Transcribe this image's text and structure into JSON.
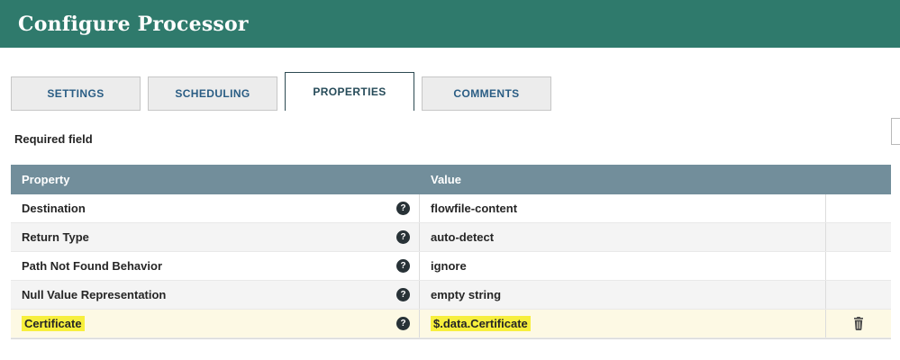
{
  "dialog": {
    "title": "Configure Processor"
  },
  "tabs": [
    {
      "label": "SETTINGS",
      "active": false
    },
    {
      "label": "SCHEDULING",
      "active": false
    },
    {
      "label": "PROPERTIES",
      "active": true
    },
    {
      "label": "COMMENTS",
      "active": false
    }
  ],
  "properties_panel": {
    "required_field_label": "Required field"
  },
  "table": {
    "columns": {
      "property": "Property",
      "value": "Value"
    },
    "rows": [
      {
        "property": "Destination",
        "value": "flowfile-content",
        "highlight": false
      },
      {
        "property": "Return Type",
        "value": "auto-detect",
        "highlight": false
      },
      {
        "property": "Path Not Found Behavior",
        "value": "ignore",
        "highlight": false
      },
      {
        "property": "Null Value Representation",
        "value": "empty string",
        "highlight": false
      },
      {
        "property": "Certificate",
        "value": "$.data.Certificate",
        "highlight": true
      }
    ]
  },
  "icons": {
    "help_glyph": "?",
    "help_name": "question-circle-icon",
    "trash_name": "trash-icon"
  },
  "colors": {
    "header_bg": "#2f7a6c",
    "table_header_bg": "#728e9b",
    "highlight": "#f7ef3c",
    "highlight_row_bg": "#fdf9e4",
    "tab_text": "#2a5d84"
  }
}
